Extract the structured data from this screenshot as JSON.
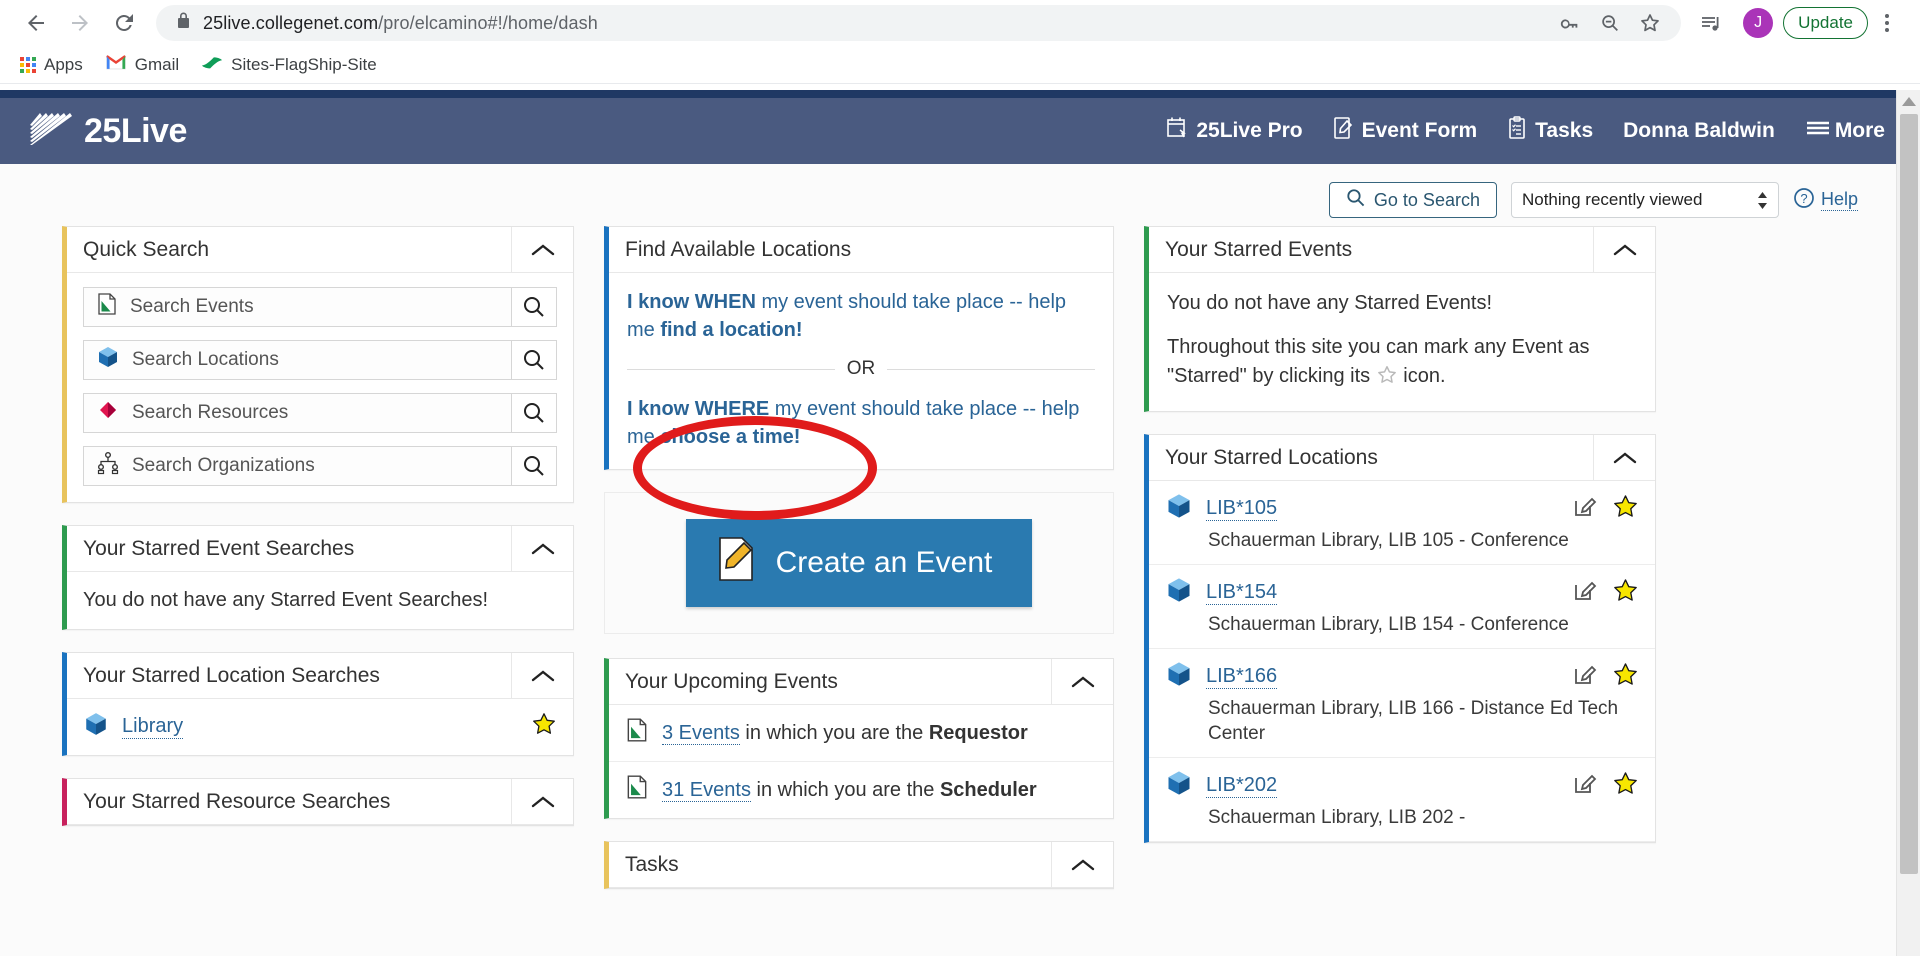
{
  "browser": {
    "back_icon": "back-arrow-icon",
    "forward_icon": "forward-arrow-icon",
    "reload_icon": "reload-icon",
    "lock_icon": "lock-icon",
    "url_domain": "25live.collegenet.com",
    "url_path": "/pro/elcamino#!/home/dash",
    "key_icon": "password-key-icon",
    "zoom_icon": "zoom-out-icon",
    "star_icon": "bookmark-star-icon",
    "media_icon": "media-list-icon",
    "profile_initial": "J",
    "update_label": "Update",
    "bookmarks": [
      {
        "label": "Apps",
        "icon": "apps-grid-icon"
      },
      {
        "label": "Gmail",
        "icon": "gmail-icon"
      },
      {
        "label": "Sites-FlagShip-Site",
        "icon": "sites-icon"
      }
    ]
  },
  "app": {
    "brand": "25Live",
    "nav": [
      {
        "label": "25Live Pro",
        "icon": "calendar-icon"
      },
      {
        "label": "Event Form",
        "icon": "event-form-icon"
      },
      {
        "label": "Tasks",
        "icon": "clipboard-icon"
      },
      {
        "label": "Donna Baldwin",
        "icon": ""
      },
      {
        "label": "More",
        "icon": "hamburger-icon"
      }
    ],
    "toolbar": {
      "go_to_search": "Go to Search",
      "recent_viewed": "Nothing recently viewed",
      "help": "Help"
    }
  },
  "quick_search": {
    "title": "Quick Search",
    "fields": [
      {
        "placeholder": "Search Events",
        "icon": "event-doc-icon"
      },
      {
        "placeholder": "Search Locations",
        "icon": "location-cube-icon"
      },
      {
        "placeholder": "Search Resources",
        "icon": "resource-diamond-icon"
      },
      {
        "placeholder": "Search Organizations",
        "icon": "organization-icon"
      }
    ]
  },
  "starred_event_searches": {
    "title": "Your Starred Event Searches",
    "empty_text": "You do not have any Starred Event Searches!"
  },
  "starred_location_searches": {
    "title": "Your Starred Location Searches",
    "items": [
      {
        "label": "Library",
        "icon": "location-cube-icon",
        "starred": true
      }
    ]
  },
  "starred_resource_searches": {
    "title": "Your Starred Resource Searches"
  },
  "find_available": {
    "title": "Find Available Locations",
    "when_bold": "I know WHEN",
    "when_mid": " my event should take place -- help me ",
    "when_bold2": "find a location!",
    "or": "OR",
    "where_bold": "I know WHERE",
    "where_mid": " my event should take place -- help me ",
    "where_bold2": "choose a time!"
  },
  "create_event": {
    "label": "Create an Event",
    "icon": "pencil-doc-icon"
  },
  "upcoming_events": {
    "title": "Your Upcoming Events",
    "rows": [
      {
        "count": "3 Events",
        "mid": " in which you are the ",
        "role": "Requestor"
      },
      {
        "count": "31 Events",
        "mid": " in which you are the ",
        "role": "Scheduler"
      }
    ]
  },
  "tasks_panel": {
    "title": "Tasks"
  },
  "starred_events": {
    "title": "Your Starred Events",
    "line1": "You do not have any Starred Events!",
    "line2_a": "Throughout this site you can mark any Event as \"Starred\" by clicking its ",
    "line2_b": " icon."
  },
  "starred_locations": {
    "title": "Your Starred Locations",
    "items": [
      {
        "code": "LIB*105",
        "desc": "Schauerman Library, LIB 105 - Conference"
      },
      {
        "code": "LIB*154",
        "desc": "Schauerman Library, LIB 154 - Conference"
      },
      {
        "code": "LIB*166",
        "desc": "Schauerman Library, LIB 166 - Distance Ed Tech Center"
      },
      {
        "code": "LIB*202",
        "desc": "Schauerman Library, LIB 202 -"
      }
    ]
  },
  "colors": {
    "header_bg": "#4a5a80",
    "top_stripe": "#1f3864",
    "accent_gold": "#e8c35c",
    "accent_green": "#2e9b4f",
    "accent_blue": "#1a73c0",
    "accent_pink": "#c8215d",
    "link_blue": "#2a6496",
    "button_blue": "#2a7ab0",
    "annotation_red": "#e01b1b"
  }
}
